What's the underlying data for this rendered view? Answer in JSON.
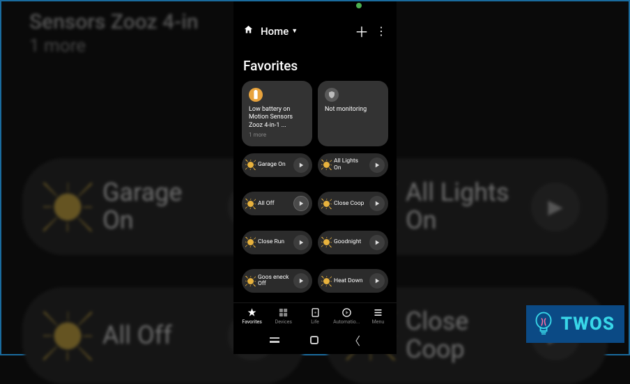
{
  "header": {
    "location_label": "Home"
  },
  "section_title": "Favorites",
  "info_cards": [
    {
      "kind": "battery",
      "title": "Low battery on Motion Sensors Zooz 4-in-1 ...",
      "subtitle": "1 more"
    },
    {
      "kind": "monitor",
      "title": "Not monitoring",
      "subtitle": ""
    }
  ],
  "scenes": [
    {
      "label": "Garage On"
    },
    {
      "label": "All Lights On"
    },
    {
      "label": "All Off",
      "highlight": true
    },
    {
      "label": "Close Coop"
    },
    {
      "label": "Close Run"
    },
    {
      "label": "Goodnight"
    },
    {
      "label": "Goos eneck Off"
    },
    {
      "label": "Heat Down"
    }
  ],
  "bottom_nav": [
    {
      "label": "Favorites",
      "active": true
    },
    {
      "label": "Devices"
    },
    {
      "label": "Life"
    },
    {
      "label": "Automatio..."
    },
    {
      "label": "Menu"
    }
  ],
  "background": {
    "top_line1": "Sensors Zooz 4-in",
    "top_line2": "1 more",
    "row1_left": "Garage On",
    "row1_right": "All Lights On",
    "row2_left": "All Off",
    "row2_right": "Close Coop"
  },
  "watermark": {
    "label": "TWOS"
  }
}
